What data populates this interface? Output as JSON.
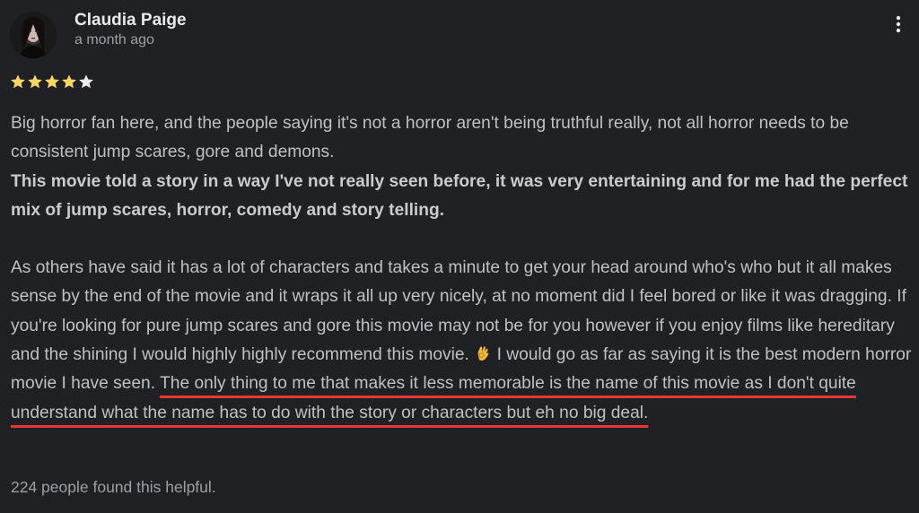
{
  "review": {
    "author": "Claudia Paige",
    "date": "a month ago",
    "rating": 4,
    "rating_max": 5,
    "star_color": "#fdd663",
    "star_empty_color": "#e8eaed",
    "para1": "Big horror fan here, and the people saying it's not a horror aren't being truthful really, not all horror needs to be consistent jump scares, gore and demons.",
    "para1_bold": "This movie told a story in a way I've not really seen before, it was very entertaining and for me had the perfect mix of jump scares, horror, comedy and story telling.",
    "para2_before_emoji": "As others have said it has a lot of characters and takes a minute to get your head around who's who but it all makes sense by the end of the movie and it wraps it all up very nicely, at no moment did I feel bored or like it was dragging. If you're looking for pure jump scares and gore this movie may not be for you however if you enjoy films like hereditary and the shining I would highly highly recommend this movie.",
    "emoji": "ok-hand-icon",
    "para2_after_emoji": " I would go as far as saying it is the best modern horror movie I have seen. ",
    "para2_highlighted": "The only thing to me that makes it less memorable is the name of this movie as I don't quite understand what the name has to do with the story or characters but eh no big deal.",
    "highlight_color": "#e53935",
    "helpful": "224 people found this helpful."
  }
}
